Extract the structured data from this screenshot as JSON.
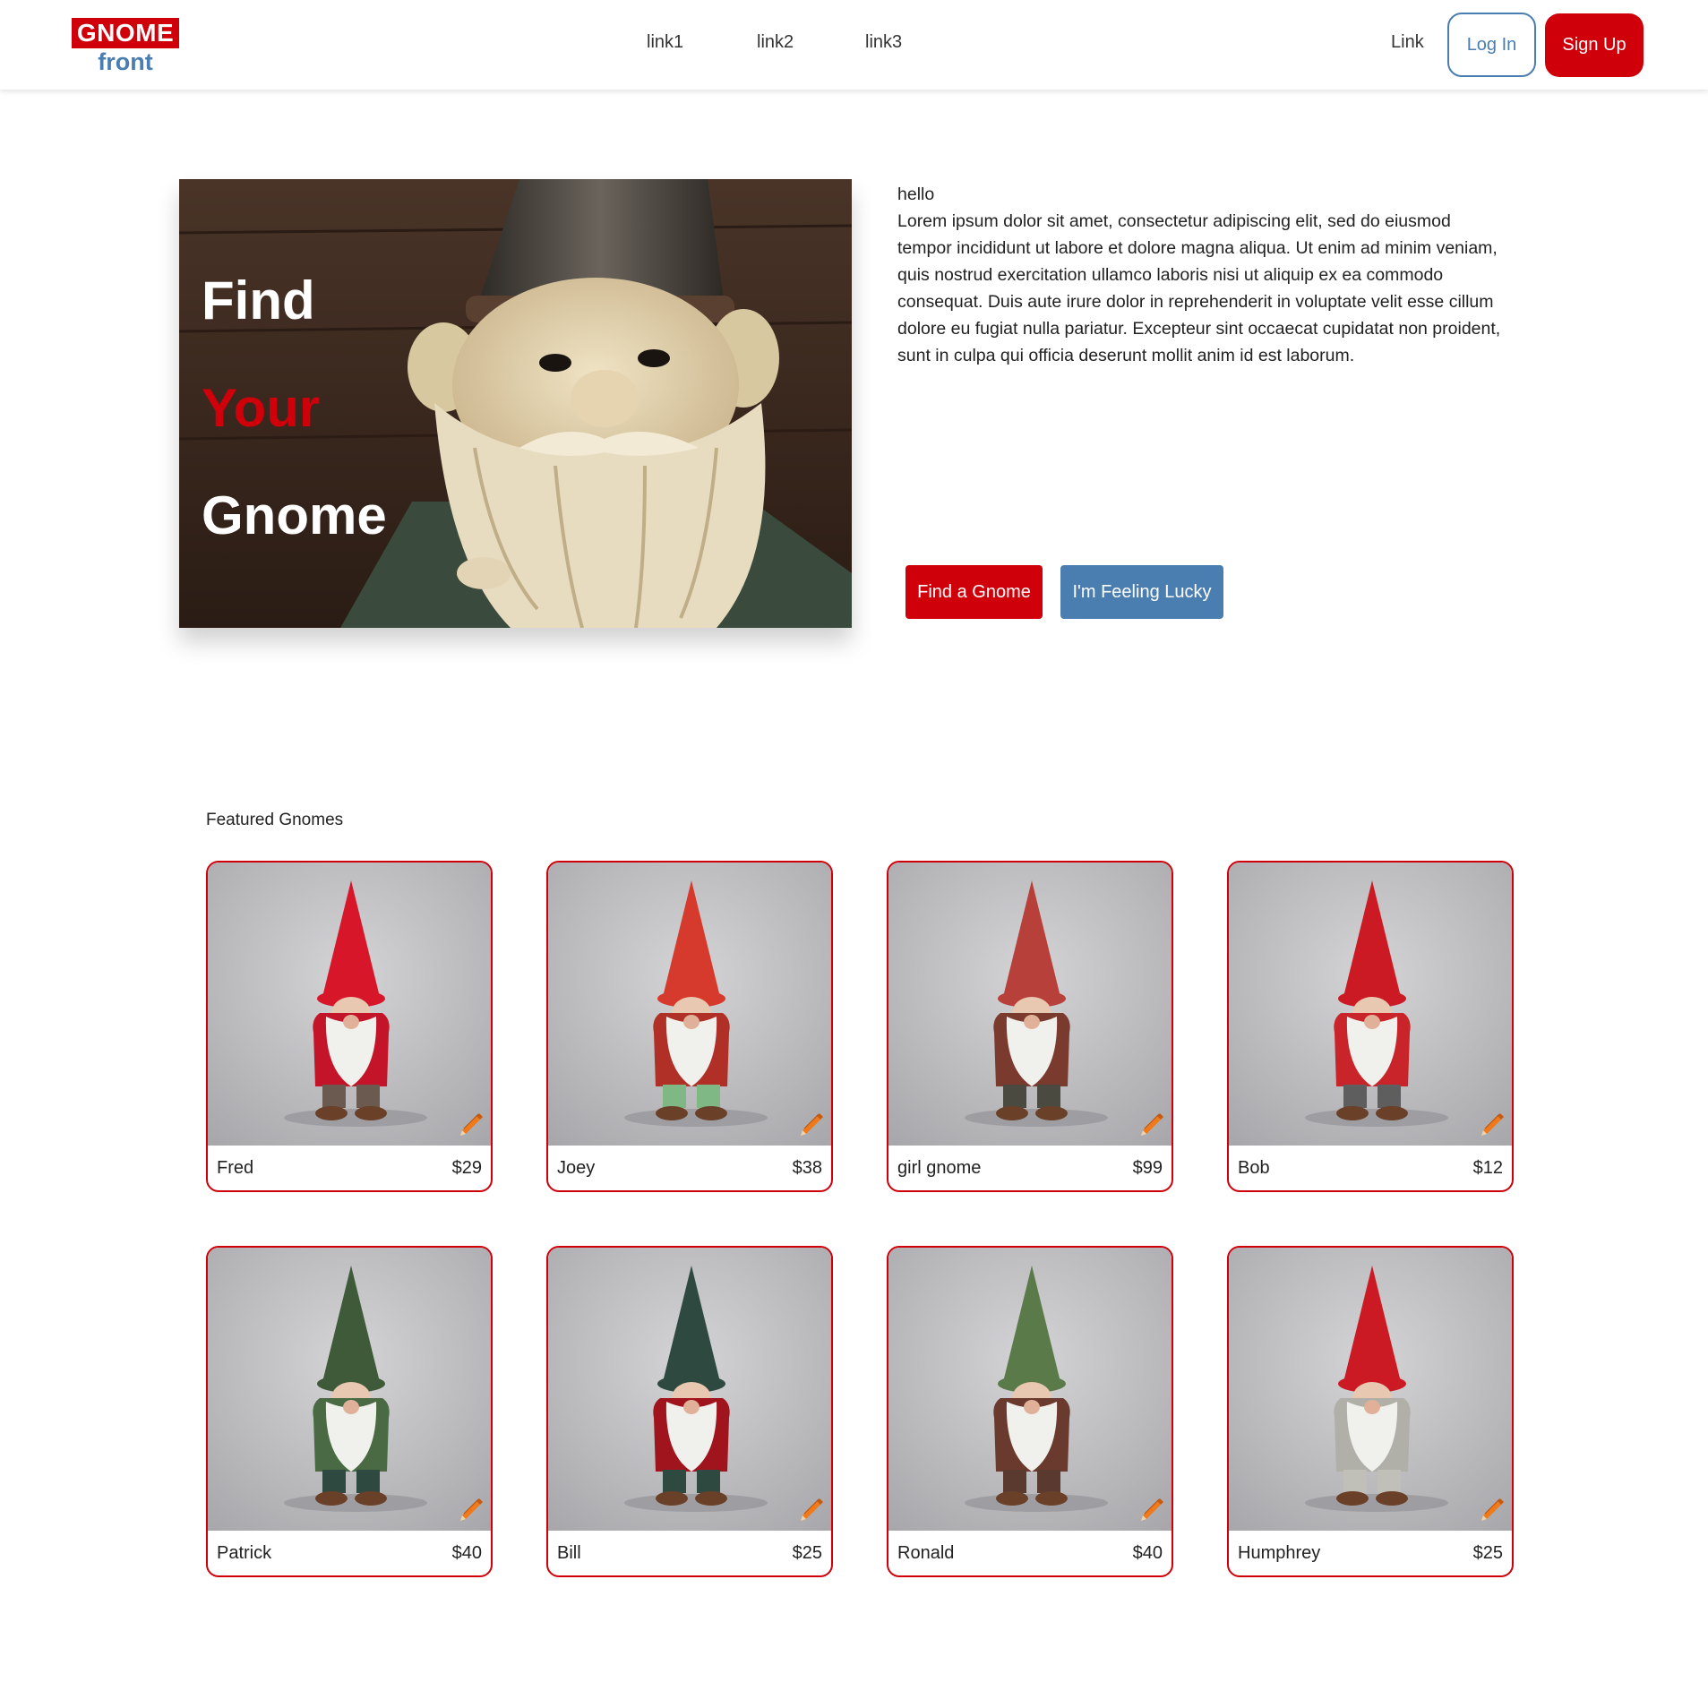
{
  "nav": {
    "logo_top": "GNOME",
    "logo_bottom": "front",
    "links": [
      "link1",
      "link2",
      "link3"
    ],
    "right_link": "Link",
    "login_label": "Log In",
    "signup_label": "Sign Up"
  },
  "hero": {
    "words": [
      "Find",
      "Your",
      "Gnome"
    ],
    "greeting": "hello",
    "body": "Lorem ipsum dolor sit amet, consectetur adipiscing elit, sed do eiusmod tempor incididunt ut labore et dolore magna aliqua. Ut enim ad minim veniam, quis nostrud exercitation ullamco laboris nisi ut aliquip ex ea commodo consequat. Duis aute irure dolor in reprehenderit in voluptate velit esse cillum dolore eu fugiat nulla pariatur. Excepteur sint occaecat cupidatat non proident, sunt in culpa qui officia deserunt mollit anim id est laborum.",
    "find_label": "Find a Gnome",
    "lucky_label": "I'm Feeling Lucky"
  },
  "featured": {
    "title": "Featured Gnomes",
    "items": [
      {
        "name": "Fred",
        "price": "$29",
        "hat": "#d8162a",
        "coat": "#c4142a",
        "pants": "#6b5a50"
      },
      {
        "name": "Joey",
        "price": "$38",
        "hat": "#d63a2c",
        "coat": "#b03028",
        "pants": "#7fb884"
      },
      {
        "name": "girl gnome",
        "price": "$99",
        "hat": "#b8403a",
        "coat": "#7a3a2e",
        "pants": "#4a4a40"
      },
      {
        "name": "Bob",
        "price": "$12",
        "hat": "#cc1a24",
        "coat": "#c8242a",
        "pants": "#5e5e5e"
      },
      {
        "name": "Patrick",
        "price": "$40",
        "hat": "#3e5a38",
        "coat": "#4a6a44",
        "pants": "#2e4a40"
      },
      {
        "name": "Bill",
        "price": "$25",
        "hat": "#2e4a40",
        "coat": "#a0141e",
        "pants": "#2e4a40"
      },
      {
        "name": "Ronald",
        "price": "$40",
        "hat": "#5a7a4a",
        "coat": "#6a3a2e",
        "pants": "#5a3a2e"
      },
      {
        "name": "Humphrey",
        "price": "$25",
        "hat": "#cc1a24",
        "coat": "#b0b0a8",
        "pants": "#c0bfb8"
      }
    ]
  },
  "colors": {
    "brand_red": "#d0000a",
    "brand_blue": "#4a7db0"
  }
}
